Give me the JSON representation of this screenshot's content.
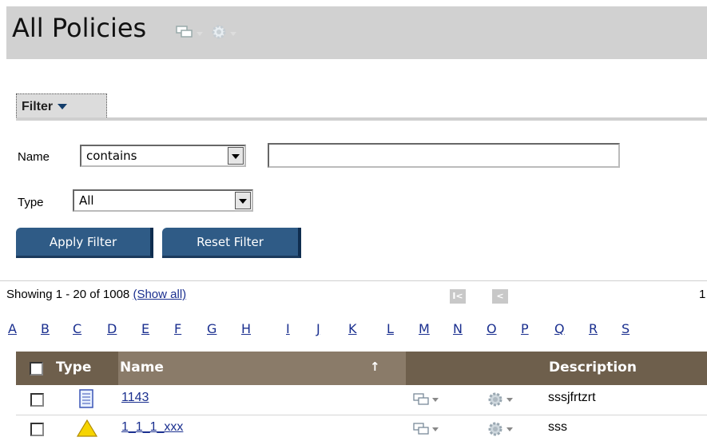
{
  "page": {
    "title": "All Policies"
  },
  "filter": {
    "tab_label": "Filter",
    "name_label": "Name",
    "name_operator": "contains",
    "name_value": "",
    "type_label": "Type",
    "type_value": "All",
    "apply_label": "Apply Filter",
    "reset_label": "Reset Filter"
  },
  "paging": {
    "showing_text": "Showing 1 - 20 of 1008",
    "show_all_label": "(Show all)",
    "first_label": "I<",
    "prev_label": "<",
    "current_page": "1"
  },
  "alphabet": [
    "A",
    "B",
    "C",
    "D",
    "E",
    "F",
    "G",
    "H",
    "I",
    "J",
    "K",
    "L",
    "M",
    "N",
    "O",
    "P",
    "Q",
    "R",
    "S"
  ],
  "table": {
    "columns": {
      "type": "Type",
      "name": "Name",
      "description": "Description"
    },
    "sort_indicator": "↑",
    "rows": [
      {
        "type_icon": "document-icon",
        "name": "1143",
        "description": "sssjfrtzrt"
      },
      {
        "type_icon": "warning-icon",
        "name": "1_1_1_xxx",
        "description": "sss"
      }
    ]
  },
  "colors": {
    "title_bar": "#d1d1d1",
    "button": "#2f5b86",
    "header": "#6e5f4c",
    "header_name": "#8a7b69",
    "link": "#1a2f8f"
  }
}
